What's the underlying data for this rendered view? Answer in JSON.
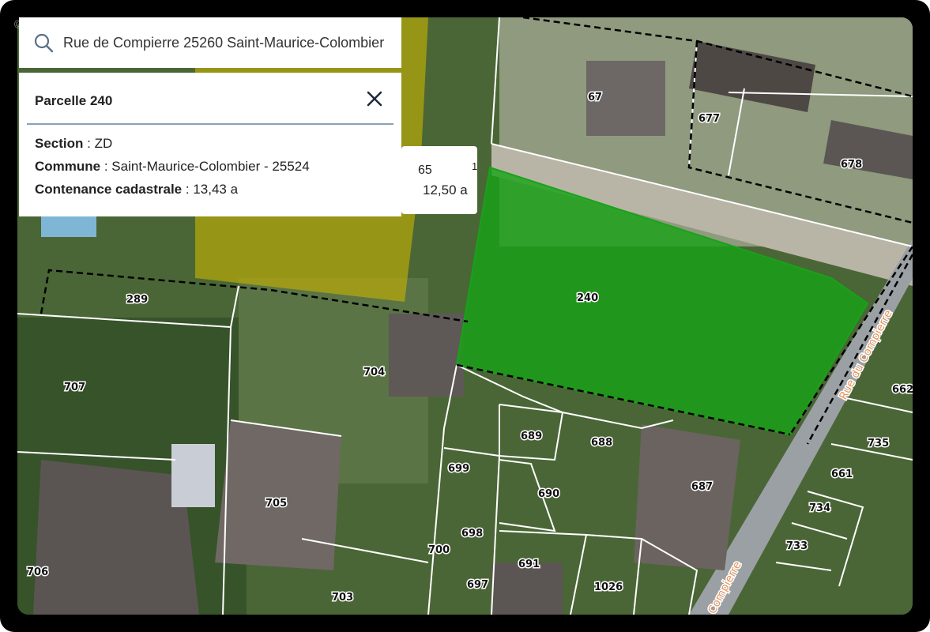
{
  "search": {
    "value": "Rue de Compierre 25260 Saint-Maurice-Colombier",
    "icon": "search-icon"
  },
  "info": {
    "title": "Parcelle 240",
    "close_icon": "close-icon",
    "section_label": "Section",
    "section_value": " : ZD",
    "commune_label": "Commune",
    "commune_value": " : Saint-Maurice-Colombier - 25524",
    "contenance_label": "Contenance cadastrale",
    "contenance_value": " : 13,43 a"
  },
  "peek": {
    "number": "65",
    "area": "12,50 a",
    "cut": "1"
  },
  "watermark": "©EtreProprio.com",
  "colors": {
    "selected": "#1aa31a",
    "other": "#c9b400",
    "boundary": "#ffffff"
  },
  "parcels": [
    "240",
    "289",
    "704",
    "707",
    "705",
    "706",
    "703",
    "700",
    "699",
    "698",
    "697",
    "689",
    "688",
    "690",
    "691",
    "687",
    "1026",
    "67",
    "677",
    "678",
    "662",
    "735",
    "661",
    "734",
    "733"
  ],
  "streets": [
    "Rue du Compierre",
    "Compierre"
  ]
}
